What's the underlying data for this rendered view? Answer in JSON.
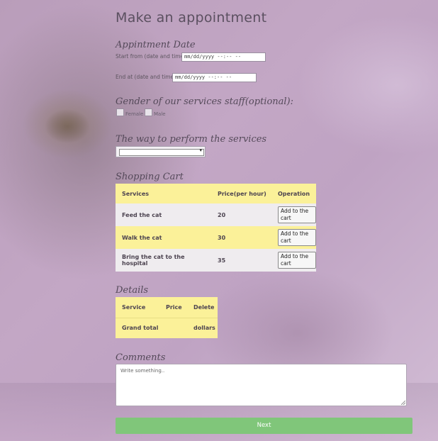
{
  "page": {
    "title": "Make an appointment",
    "colors": {
      "table_yellow": "#fbf199",
      "table_gray": "#efecef",
      "next_green": "#80c67a"
    }
  },
  "appointment_date": {
    "section_title": "Appintment Date",
    "start_label": "Start from (date and time):",
    "start_value": "mm/dd/yyyy --:-- --",
    "end_label": "End at (date and time):",
    "end_value": "mm/dd/yyyy --:-- --"
  },
  "gender": {
    "section_title": "Gender of our services staff(optional):",
    "options": [
      {
        "label": "Female",
        "checked": false
      },
      {
        "label": "Male",
        "checked": false
      }
    ]
  },
  "perform": {
    "section_title": "The way to perform the services",
    "selected": ""
  },
  "cart": {
    "section_title": "Shopping Cart",
    "headers": [
      "Services",
      "Price(per hour)",
      "Operation"
    ],
    "rows": [
      {
        "service": "Feed the cat",
        "price": "20",
        "action": "Add to the cart"
      },
      {
        "service": "Walk the cat",
        "price": "30",
        "action": "Add to the cart"
      },
      {
        "service": "Bring the cat to the hospital",
        "price": "35",
        "action": "Add to the cart"
      }
    ]
  },
  "details": {
    "section_title": "Details",
    "headers": [
      "Service",
      "Price",
      "Delete"
    ],
    "total_label": "Grand total",
    "total_unit": "dollars"
  },
  "comments": {
    "section_title": "Comments",
    "placeholder": "Write something.."
  },
  "next_label": "Next"
}
